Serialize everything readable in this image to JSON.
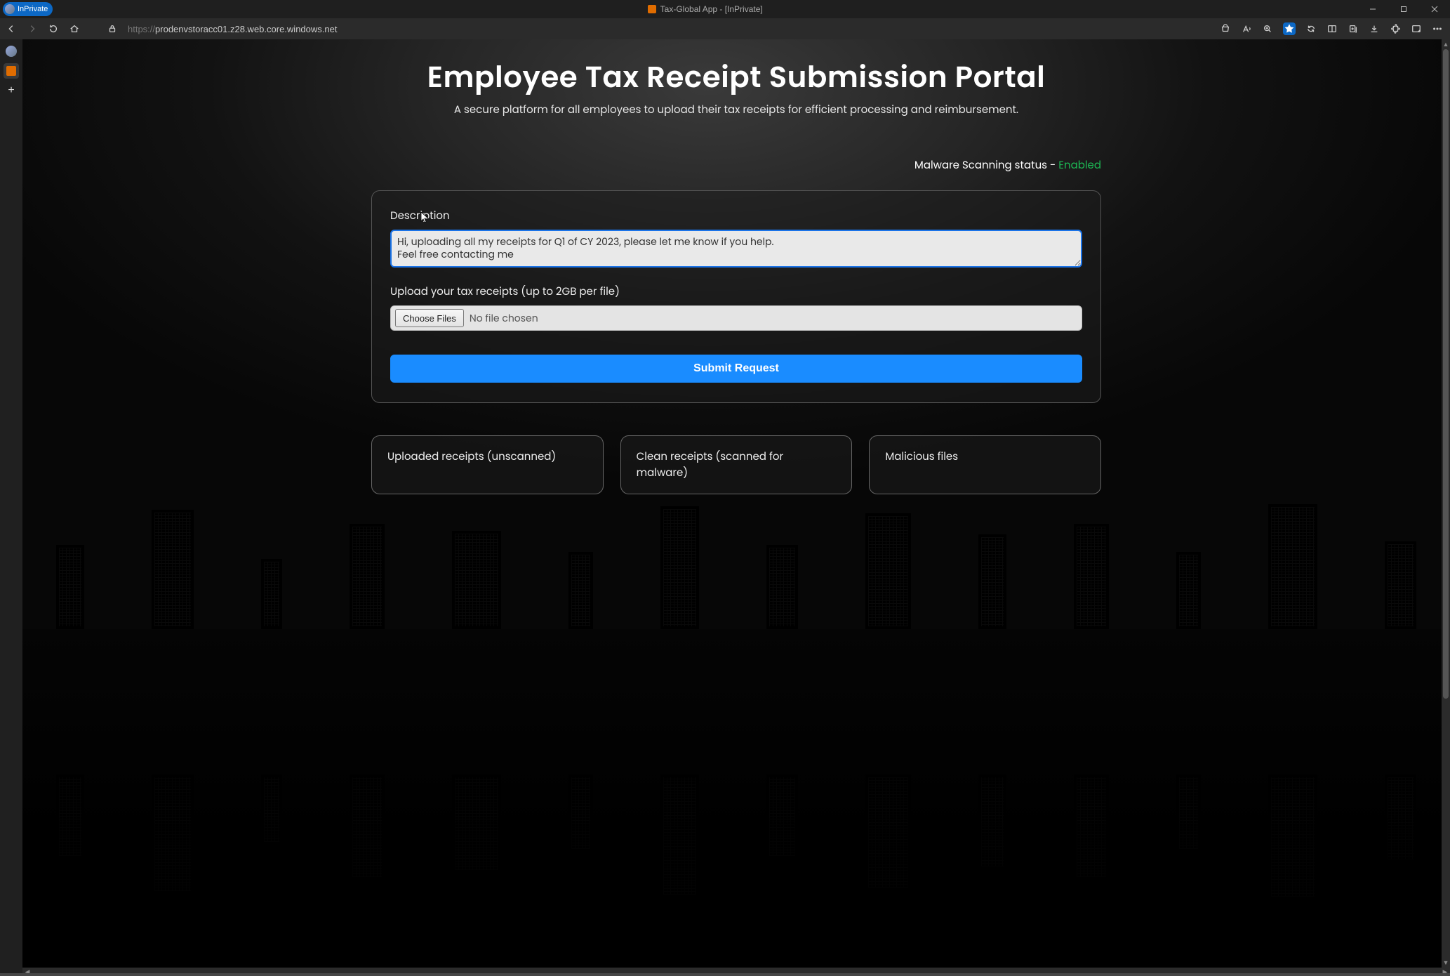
{
  "browser": {
    "inprivate_label": "InPrivate",
    "window_title": "Tax-Global App - [InPrivate]",
    "url_proto": "https://",
    "url_host": "prodenvstoracc01.z28.web.core.windows.net",
    "minimize_title": "Minimize",
    "maximize_title": "Maximize",
    "close_title": "Close"
  },
  "page": {
    "heading": "Employee Tax Receipt Submission Portal",
    "subtitle": "A secure platform for all employees to upload their tax receipts for efficient processing and reimbursement.",
    "scan_status_prefix": "Malware Scanning status - ",
    "scan_status_value": "Enabled",
    "description_label": "Description",
    "description_value": "Hi, uploading all my receipts for Q1 of CY 2023, please let me know if you help.\nFeel free contacting me",
    "upload_label": "Upload your tax receipts (up to 2GB per file)",
    "choose_files": "Choose Files",
    "choose_files_status": "No file chosen",
    "submit_label": "Submit Request",
    "cards": {
      "uploaded": "Uploaded receipts (unscanned)",
      "clean": "Clean receipts (scanned for malware)",
      "malicious": "Malicious files"
    }
  }
}
